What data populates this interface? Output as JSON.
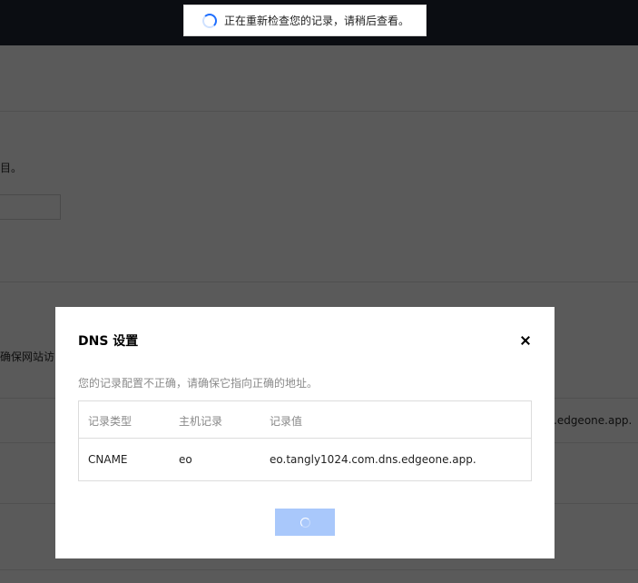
{
  "toast": {
    "text": "正在重新检查您的记录，请稍后查看。",
    "icon": "loading-spinner-icon"
  },
  "background": {
    "partial_text_1": "目。",
    "partial_text_2": "确保网站访",
    "partial_text_3": ".edgeone.app."
  },
  "dialog": {
    "title": "DNS 设置",
    "description": "您的记录配置不正确，请确保它指向正确的地址。",
    "table": {
      "headers": [
        "记录类型",
        "主机记录",
        "记录值"
      ],
      "rows": [
        [
          "CNAME",
          "eo",
          "eo.tangly1024.com.dns.edgeone.app."
        ]
      ]
    },
    "confirm_button": {
      "state": "loading",
      "color": "#a9c8fb"
    }
  },
  "colors": {
    "accent": "#1f6fff",
    "overlay": "#5a5a5a"
  }
}
